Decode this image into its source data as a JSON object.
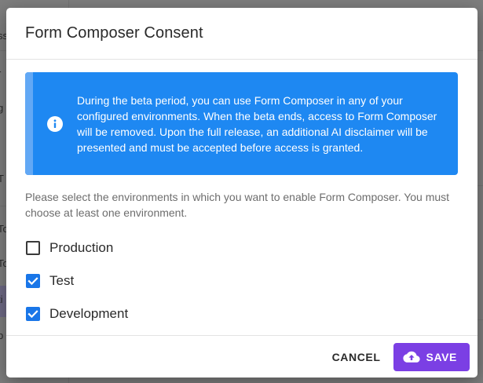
{
  "background": {
    "sidebar_fragments": [
      "ss",
      "r",
      "g",
      "T",
      "To",
      "To",
      "ti",
      "b"
    ]
  },
  "dialog": {
    "title": "Form Composer Consent",
    "info": {
      "icon": "info-icon",
      "text": "During the beta period, you can use Form Composer in any of your configured environments. When the beta ends, access to Form Composer will be removed. Upon the full release, an additional AI disclaimer will be presented and must be accepted before access is granted."
    },
    "instructions": "Please select the environments in which you want to enable Form Composer. You must choose at least one environment.",
    "environments": [
      {
        "label": "Production",
        "checked": false
      },
      {
        "label": "Test",
        "checked": true
      },
      {
        "label": "Development",
        "checked": true
      }
    ],
    "footer": {
      "cancel_label": "CANCEL",
      "save_label": "SAVE",
      "save_icon": "cloud-upload-icon"
    }
  },
  "colors": {
    "info_banner": "#1e88f2",
    "checkbox_checked": "#1976e8",
    "save_button": "#7b3fe4"
  }
}
